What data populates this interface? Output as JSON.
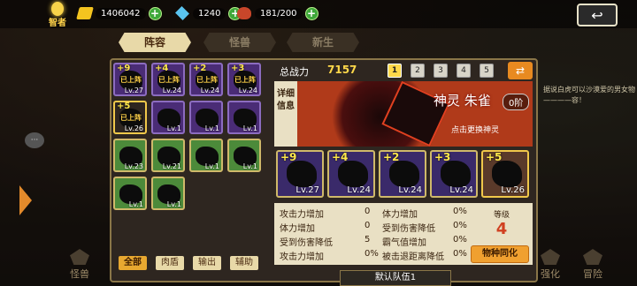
{
  "topbar": {
    "sage_label": "智者",
    "gold": "1406042",
    "gems": "1240",
    "meat": "181/200",
    "gold_icon": "gold-coin-icon",
    "gem_icon": "gem-icon",
    "meat_icon": "meat-icon",
    "back_icon": "back-arrow-icon"
  },
  "tabs": [
    {
      "label": "阵容",
      "active": true
    },
    {
      "label": "怪兽",
      "active": false
    },
    {
      "label": "新生",
      "active": false
    }
  ],
  "bottom_nav": {
    "left_label": "怪兽",
    "right_labels": [
      "强化",
      "冒险"
    ]
  },
  "grid": {
    "cards": [
      {
        "plus": "+9",
        "tag": "已上阵",
        "lv": "Lv.27",
        "style": "purple"
      },
      {
        "plus": "+4",
        "tag": "已上阵",
        "lv": "Lv.24",
        "style": "purple"
      },
      {
        "plus": "+2",
        "tag": "已上阵",
        "lv": "Lv.24",
        "style": "purple"
      },
      {
        "plus": "+3",
        "tag": "已上阵",
        "lv": "Lv.24",
        "style": "purple"
      },
      {
        "plus": "+5",
        "tag": "已上阵",
        "lv": "Lv.26",
        "style": "gold"
      },
      {
        "plus": "",
        "tag": "",
        "lv": "Lv.1",
        "style": "purple"
      },
      {
        "plus": "",
        "tag": "",
        "lv": "Lv.1",
        "style": "purple"
      },
      {
        "plus": "",
        "tag": "",
        "lv": "Lv.1",
        "style": "purple"
      },
      {
        "plus": "",
        "tag": "",
        "lv": "Lv.23",
        "style": "green"
      },
      {
        "plus": "",
        "tag": "",
        "lv": "Lv.21",
        "style": "green"
      },
      {
        "plus": "",
        "tag": "",
        "lv": "Lv.1",
        "style": "green"
      },
      {
        "plus": "",
        "tag": "",
        "lv": "Lv.1",
        "style": "green"
      },
      {
        "plus": "",
        "tag": "",
        "lv": "Lv.1",
        "style": "green"
      },
      {
        "plus": "",
        "tag": "",
        "lv": "Lv.1",
        "style": "green"
      }
    ]
  },
  "filters": [
    "全部",
    "肉盾",
    "输出",
    "辅助"
  ],
  "power": {
    "label": "总战力",
    "value": "7157",
    "pages": [
      "1",
      "2",
      "3",
      "4",
      "5"
    ]
  },
  "detail": {
    "tab_label": "详细信息",
    "spirit_name": "神灵 朱雀",
    "rank": "0阶",
    "hint": "点击更换神灵"
  },
  "team": [
    {
      "plus": "+9",
      "lv": "Lv.27",
      "style": "purple"
    },
    {
      "plus": "+4",
      "lv": "Lv.24",
      "style": "purple"
    },
    {
      "plus": "+2",
      "lv": "Lv.24",
      "style": "purple"
    },
    {
      "plus": "+3",
      "lv": "Lv.24",
      "style": "purple"
    },
    {
      "plus": "+5",
      "lv": "Lv.26",
      "style": "gold"
    }
  ],
  "stats": {
    "rows": [
      {
        "l1": "攻击力增加",
        "v1": "0",
        "l2": "体力增加",
        "v2": "0%"
      },
      {
        "l1": "体力增加",
        "v1": "0",
        "l2": "受到伤害降低",
        "v2": "0%"
      },
      {
        "l1": "受到伤害降低",
        "v1": "5",
        "l2": "霸气值增加",
        "v2": "0%"
      },
      {
        "l1": "攻击力增加",
        "v1": "0%",
        "l2": "被击退距离降低",
        "v2": "0%"
      }
    ],
    "level_label": "等级",
    "level_value": "4",
    "synth_label": "物种同化"
  },
  "default_team": "默认队伍1",
  "right_text": "据说白虎可以沙漠爱的男女物————容！"
}
